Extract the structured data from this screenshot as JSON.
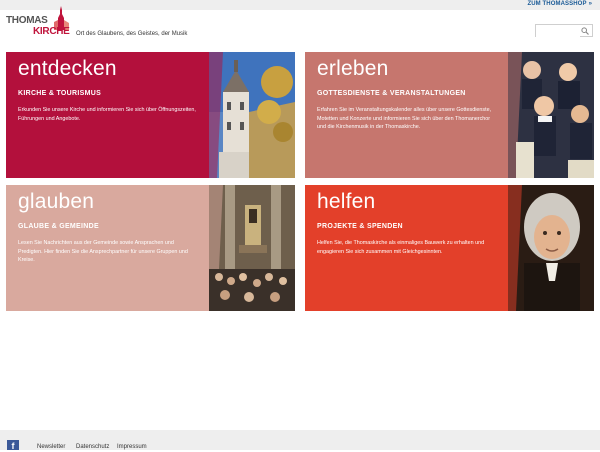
{
  "header": {
    "shop_link": "ZUM THOMASSHOP",
    "logo_line1": "THOMAS",
    "logo_line2": "KIRCHE",
    "tagline": "Ort des Glaubens, des Geistes, der Musik",
    "search_placeholder": ""
  },
  "tiles": [
    {
      "title": "entdecken",
      "subtitle": "KIRCHE & TOURISMUS",
      "description": "Erkunden Sie unsere Kirche und informieren Sie sich über Öffnungszeiten, Führungen und Angebote.",
      "color": "#b3103c"
    },
    {
      "title": "erleben",
      "subtitle": "GOTTESDIENSTE & VERANSTALTUNGEN",
      "description": "Erfahren Sie im Veranstaltungskalender alles über unsere Gottesdienste, Motetten und Konzerte und informieren Sie sich über den Thomanerchor und die Kirchenmusik in der Thomaskirche.",
      "color": "#c6766e"
    },
    {
      "title": "glauben",
      "subtitle": "GLAUBE & GEMEINDE",
      "description": "Lesen Sie Nachrichten aus der Gemeinde sowie Ansprachen und Predigten. Hier finden Sie die Ansprechpartner für unsere Gruppen und Kreise.",
      "color": "#d9a99e"
    },
    {
      "title": "helfen",
      "subtitle": "PROJEKTE & SPENDEN",
      "description": "Helfen Sie, die Thomaskirche als einmaliges Bauwerk zu erhalten und engagieren Sie sich zusammen mit Gleichgesinnten.",
      "color": "#e3402a"
    }
  ],
  "footer": {
    "links": [
      "Newsletter",
      "Datenschutz",
      "Impressum"
    ],
    "facebook_icon": "f"
  }
}
